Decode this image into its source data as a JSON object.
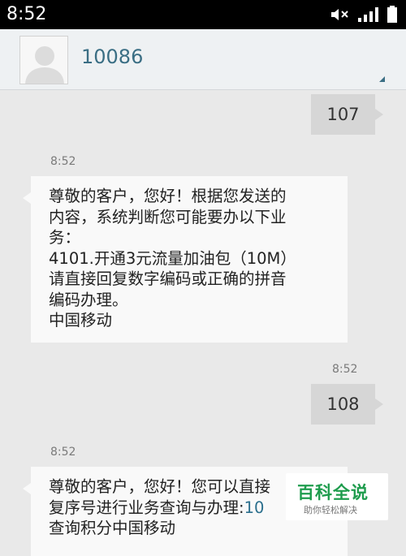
{
  "status_bar": {
    "time": "8:52",
    "icons": [
      "volume-muted-icon",
      "signal-icon",
      "battery-icon"
    ]
  },
  "header": {
    "contact": "10086",
    "avatar": "default-avatar-icon"
  },
  "messages": [
    {
      "direction": "out",
      "text": "107"
    },
    {
      "direction": "in",
      "time": "8:52",
      "lines": [
        "尊敬的客户，您好！根据您发送的",
        "内容，系统判断您可能要办以下业",
        "务：",
        "4101.开通3元流量加油包（10M）",
        "请直接回复数字编码或正确的拼音",
        "编码办理。",
        "中国移动"
      ]
    },
    {
      "direction": "out",
      "time": "8:52",
      "text": "108"
    },
    {
      "direction": "in",
      "time": "8:52",
      "line1": "尊敬的客户，您好！您可以直接",
      "line2_text": "复序号进行业务查询与办理:",
      "line2_link": "10",
      "line3": "查询积分中国移动"
    }
  ],
  "watermark": {
    "title": "百科全说",
    "subtitle": "助你轻松解决"
  },
  "colors": {
    "bubble_out": "#d6d6d6",
    "bubble_in": "#f9f9f9",
    "link": "#2b6f8d",
    "watermark": "#1e9c4d"
  }
}
